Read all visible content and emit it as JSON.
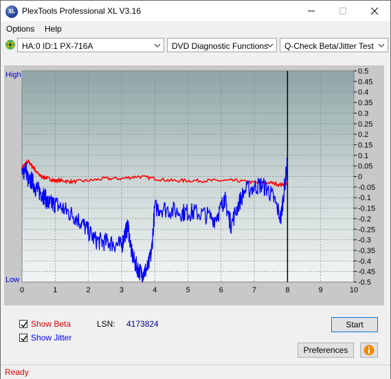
{
  "window": {
    "title": "PlexTools Professional XL V3.16",
    "app_icon_text": "XL"
  },
  "menu": {
    "items": [
      {
        "label": "Options"
      },
      {
        "label": "Help"
      }
    ]
  },
  "toolbar": {
    "drive": "HA:0 ID:1  PX-716A",
    "function": "DVD Diagnostic Functions",
    "test": "Q-Check Beta/Jitter Test"
  },
  "chart_data": {
    "type": "line",
    "x_ticks": [
      "0",
      "1",
      "2",
      "3",
      "4",
      "5",
      "6",
      "7",
      "8",
      "9",
      "10"
    ],
    "y_right_ticks": [
      "0.5",
      "0.45",
      "0.4",
      "0.35",
      "0.3",
      "0.25",
      "0.2",
      "0.15",
      "0.1",
      "0.05",
      "0",
      "-0.05",
      "-0.1",
      "-0.15",
      "-0.2",
      "-0.25",
      "-0.3",
      "-0.35",
      "-0.4",
      "-0.45",
      "-0.5"
    ],
    "y_left_top": "High",
    "y_left_bottom": "Low",
    "xlim": [
      0,
      10
    ],
    "ylim": [
      -0.5,
      0.5
    ],
    "end_marker_x": 8.0,
    "series": [
      {
        "name": "Beta",
        "color": "#ff0000",
        "x": [
          0,
          0.1,
          0.2,
          0.3,
          0.4,
          0.5,
          0.6,
          0.8,
          1.0,
          1.2,
          1.5,
          2.0,
          2.5,
          3.0,
          3.5,
          4.0,
          4.5,
          5.0,
          5.5,
          6.0,
          6.5,
          7.0,
          7.5,
          7.8,
          8.0
        ],
        "y": [
          0.04,
          0.06,
          0.07,
          0.05,
          0.03,
          0.01,
          0.0,
          -0.01,
          -0.02,
          -0.02,
          -0.025,
          -0.02,
          -0.01,
          -0.01,
          0.0,
          -0.01,
          -0.02,
          -0.02,
          -0.02,
          -0.02,
          -0.02,
          -0.03,
          -0.03,
          -0.04,
          -0.03
        ]
      },
      {
        "name": "Jitter",
        "color": "#0000ff",
        "x": [
          0,
          0.1,
          0.2,
          0.3,
          0.4,
          0.5,
          0.6,
          0.7,
          0.8,
          0.9,
          1.0,
          1.2,
          1.4,
          1.6,
          1.8,
          2.0,
          2.2,
          2.4,
          2.6,
          2.8,
          3.0,
          3.1,
          3.2,
          3.3,
          3.4,
          3.5,
          3.6,
          3.7,
          3.8,
          3.9,
          4.0,
          4.2,
          4.5,
          4.8,
          5.0,
          5.2,
          5.5,
          5.8,
          6.0,
          6.1,
          6.2,
          6.3,
          6.5,
          6.7,
          7.0,
          7.2,
          7.4,
          7.6,
          7.8,
          7.9,
          8.0
        ],
        "y": [
          0.0,
          0.05,
          -0.03,
          -0.02,
          -0.05,
          -0.07,
          -0.08,
          -0.1,
          -0.13,
          -0.13,
          -0.13,
          -0.15,
          -0.17,
          -0.19,
          -0.22,
          -0.26,
          -0.3,
          -0.31,
          -0.31,
          -0.32,
          -0.33,
          -0.27,
          -0.24,
          -0.36,
          -0.41,
          -0.44,
          -0.46,
          -0.45,
          -0.43,
          -0.36,
          -0.15,
          -0.15,
          -0.16,
          -0.17,
          -0.17,
          -0.17,
          -0.18,
          -0.2,
          -0.15,
          -0.1,
          -0.17,
          -0.23,
          -0.14,
          -0.07,
          -0.05,
          -0.04,
          -0.06,
          -0.11,
          -0.2,
          -0.06,
          0.07
        ]
      }
    ]
  },
  "legend": {
    "beta_label": "Show Beta",
    "jitter_label": "Show Jitter",
    "beta_color": "#e00000",
    "jitter_color": "#0000ff",
    "lsn_label": "LSN:",
    "lsn_value": "4173824"
  },
  "buttons": {
    "start": "Start",
    "preferences": "Preferences",
    "info_icon": "info-icon"
  },
  "status": {
    "text": "Ready"
  }
}
